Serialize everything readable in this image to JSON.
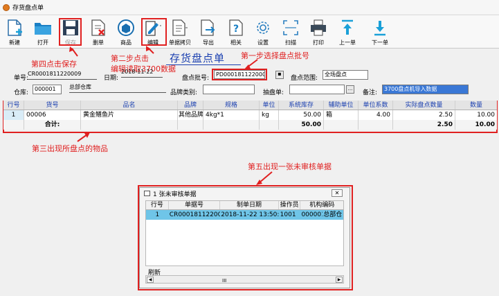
{
  "window": {
    "title": "存货盘点单"
  },
  "toolbar": {
    "items": [
      {
        "label": "新建",
        "icon": "new-doc-icon"
      },
      {
        "label": "打开",
        "icon": "folder-icon"
      },
      {
        "label": "保存",
        "icon": "save-icon"
      },
      {
        "label": "删单",
        "icon": "delete-doc-icon"
      },
      {
        "label": "商品",
        "icon": "goods-icon"
      },
      {
        "label": "编辑",
        "icon": "edit-icon"
      },
      {
        "label": "单据拷贝",
        "icon": "copy-doc-icon"
      },
      {
        "label": "导出",
        "icon": "export-icon"
      },
      {
        "label": "相关",
        "icon": "help-doc-icon"
      },
      {
        "label": "设置",
        "icon": "gear-icon"
      },
      {
        "label": "扫描",
        "icon": "scan-icon"
      },
      {
        "label": "打印",
        "icon": "printer-icon"
      },
      {
        "label": "上一单",
        "icon": "arrow-up-icon"
      },
      {
        "label": "下一单",
        "icon": "arrow-down-icon"
      }
    ]
  },
  "annotations": {
    "step1": "第一步选择盘点批号",
    "step2_line1": "第二步点击",
    "step2_line2": "编辑读取3700数据",
    "step3": "第三出现所盘点的物品",
    "step4": "第四点击保存",
    "step5": "第五出现一张未审核单据"
  },
  "form": {
    "title": "存货盘点单",
    "doc_no_label": "单号:",
    "doc_no": "CR0001811220009",
    "date_label": "日期:",
    "date": "2018-11-22",
    "batch_label": "盘点批号:",
    "batch": "PD0001811220009",
    "range_label": "盘点范围:",
    "range": "全场盘点",
    "warehouse_label": "仓库:",
    "warehouse_code": "000001",
    "warehouse_name": "总部仓库",
    "brand_label": "品牌类别:",
    "brand": "",
    "counter_label": "抽盘单:",
    "counter": "",
    "remark_label": "备注:",
    "remark": "3700盘点机导入数据"
  },
  "grid": {
    "headers": [
      "行号",
      "货号",
      "品名",
      "品牌",
      "规格",
      "单位",
      "系统库存",
      "辅助单位",
      "单位系数",
      "实际盘点数量",
      "数量"
    ],
    "rows": [
      {
        "no": "1",
        "code": "00006",
        "name": "黄金鳝鱼片",
        "brand": "其他品牌",
        "spec": "4kg*1",
        "unit": "kg",
        "stock": "50.00",
        "aux_unit": "箱",
        "factor": "4.00",
        "actual": "2.50",
        "qty": "10.00"
      }
    ],
    "summary": {
      "label": "合计:",
      "stock": "50.00",
      "actual": "2.50",
      "qty": "10.00"
    }
  },
  "popup": {
    "title": "1 张未审核单据",
    "headers": [
      "行号",
      "单据号",
      "制单日期",
      "操作员",
      "机构编码"
    ],
    "rows": [
      {
        "no": "1",
        "doc_no": "CR0001811220009",
        "date": "2018-11-22 13:50:39",
        "operator": "1001",
        "org_code": "000001",
        "org_name": "总部仓"
      }
    ],
    "refresh_label": "刷新"
  }
}
